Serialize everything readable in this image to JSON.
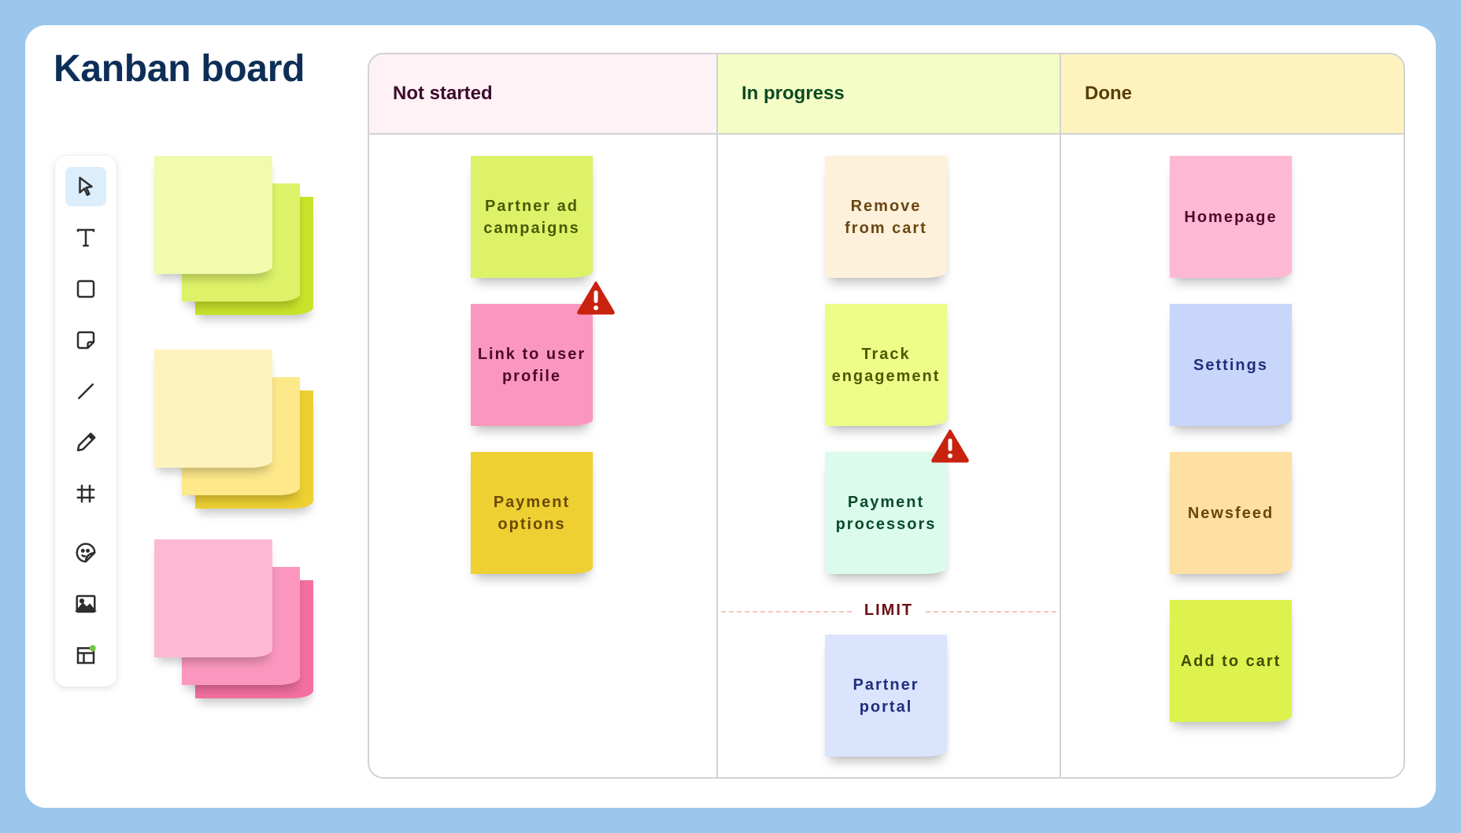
{
  "title": "Kanban board",
  "colors": {
    "background": "#9AC7EB",
    "title": "#0D2E57",
    "warning": "#C8230F",
    "limit_text": "#6B0F14",
    "notification_dot": "#7BC043"
  },
  "toolbar": {
    "tools": [
      {
        "name": "select",
        "icon": "cursor-icon",
        "active": true
      },
      {
        "name": "text",
        "icon": "text-icon"
      },
      {
        "name": "shape",
        "icon": "square-icon"
      },
      {
        "name": "sticky-note",
        "icon": "sticky-note-icon"
      },
      {
        "name": "line",
        "icon": "line-icon"
      },
      {
        "name": "pen",
        "icon": "pencil-icon"
      },
      {
        "name": "frame",
        "icon": "hash-frame-icon"
      },
      {
        "name": "sticker",
        "icon": "sticker-icon"
      },
      {
        "name": "image",
        "icon": "image-icon"
      },
      {
        "name": "templates",
        "icon": "layout-icon",
        "badge": "notification-dot"
      }
    ]
  },
  "sticky_palette": [
    {
      "name": "lime",
      "colors": [
        "#F1FBAE",
        "#DDF269",
        "#C9E32A"
      ]
    },
    {
      "name": "yellow",
      "colors": [
        "#FEF3BE",
        "#FDE88A",
        "#EED033"
      ]
    },
    {
      "name": "pink",
      "colors": [
        "#FDB9D4",
        "#FB97BE",
        "#F36FA0"
      ]
    }
  ],
  "board": {
    "columns": [
      {
        "title": "Not started",
        "header_bg": "#FEF2F6",
        "header_color": "#3D0A2C",
        "cards": [
          {
            "text": "Partner ad campaigns",
            "bg": "#DDF269",
            "color": "#4A5A05",
            "warning": false
          },
          {
            "text": "Link to user profile",
            "bg": "#FB97BE",
            "color": "#4D0A2C",
            "warning": true
          },
          {
            "text": "Payment options",
            "bg": "#EED033",
            "color": "#6B4A05",
            "warning": false
          }
        ]
      },
      {
        "title": "In progress",
        "header_bg": "#F4FDC6",
        "header_color": "#0B4A22",
        "limit_label": "LIMIT",
        "cards": [
          {
            "text": "Remove from cart",
            "bg": "#FEF1DC",
            "color": "#6B4510",
            "warning": false
          },
          {
            "text": "Track engagement",
            "bg": "#EEFC88",
            "color": "#4A5A05",
            "warning": false
          },
          {
            "text": "Payment processors",
            "bg": "#DBFCEC",
            "color": "#0B4A2E",
            "warning": true
          },
          {
            "text": "Partner portal",
            "bg": "#DBE4FD",
            "color": "#1E2F7A",
            "warning": false,
            "beyond_limit": true
          }
        ]
      },
      {
        "title": "Done",
        "header_bg": "#FEF3BE",
        "header_color": "#5A3E05",
        "cards": [
          {
            "text": "Homepage",
            "bg": "#FDB9D4",
            "color": "#4D0A2C",
            "warning": false
          },
          {
            "text": "Settings",
            "bg": "#C9D6FC",
            "color": "#1E2F7A",
            "warning": false
          },
          {
            "text": "Newsfeed",
            "bg": "#FDE0A2",
            "color": "#6B4510",
            "warning": false
          },
          {
            "text": "Add to cart",
            "bg": "#DDF24E",
            "color": "#3F4E05",
            "warning": false
          }
        ]
      }
    ]
  }
}
